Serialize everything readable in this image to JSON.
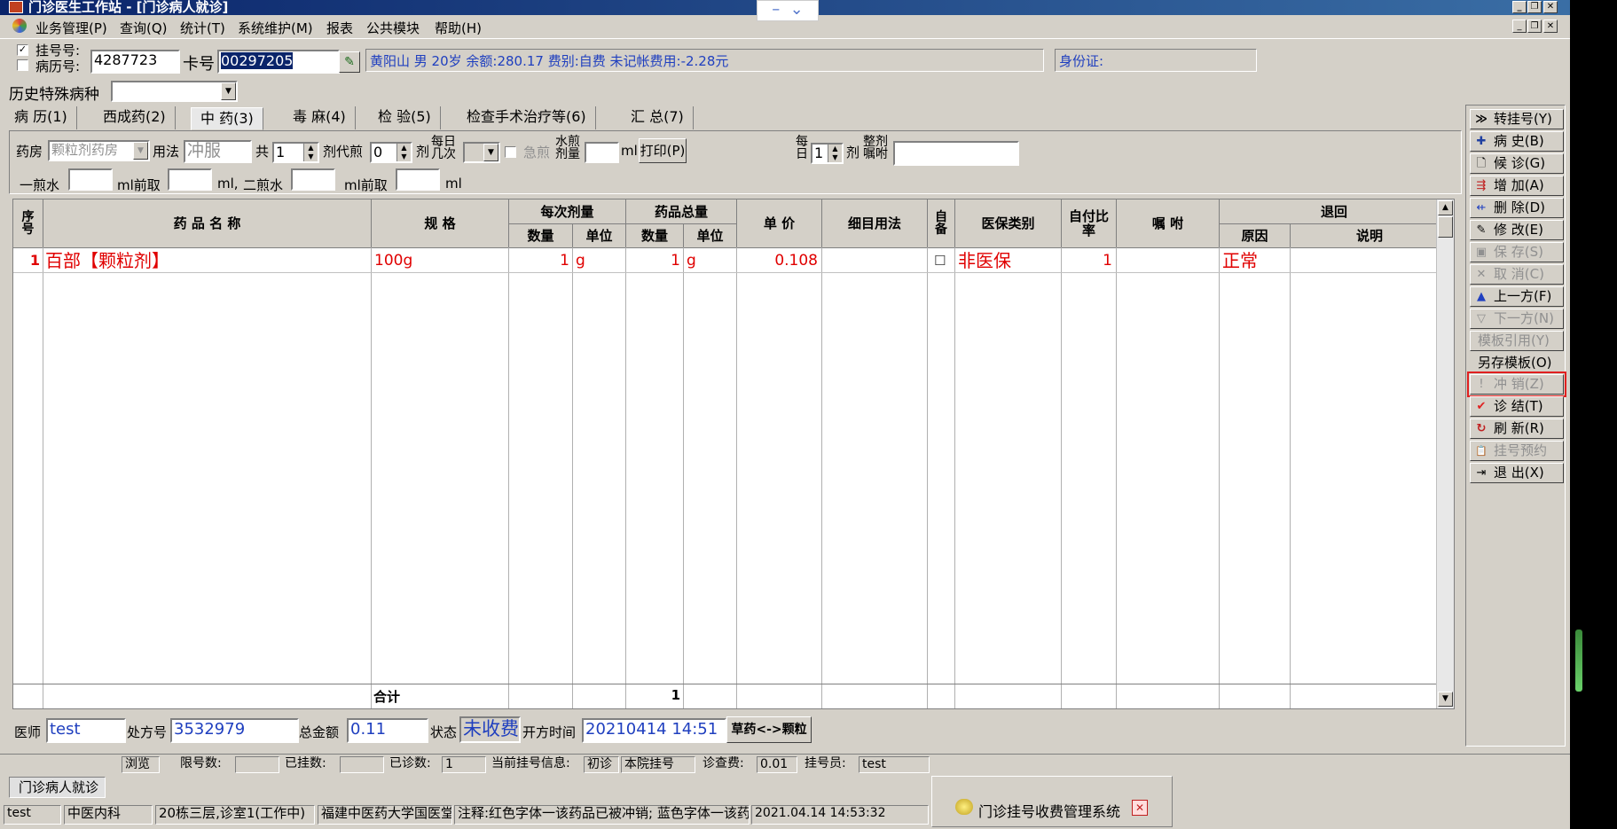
{
  "window": {
    "title": "门诊医生工作站 - [门诊病人就诊]"
  },
  "menu": [
    "业务管理(P)",
    "查询(Q)",
    "统计(T)",
    "系统维护(M)",
    "报表",
    "公共模块",
    "帮助(H)"
  ],
  "patient": {
    "reg_no_label": "挂号号:",
    "record_no_label": "病历号:",
    "reg_no": "4287723",
    "card_label": "卡号",
    "card_no": "00297205",
    "info": "黄阳山 男 20岁 余额:280.17 费别:自费 未记帐费用:-2.28元",
    "id_label": "身份证:",
    "history_label": "历史特殊病种"
  },
  "tabs": [
    "病 历(1)",
    "西成药(2)",
    "中 药(3)",
    "毒 麻(4)",
    "检 验(5)",
    "检查手术治疗等(6)",
    "汇 总(7)"
  ],
  "active_tab": 2,
  "herb": {
    "pharmacy_label": "药房",
    "pharmacy": "颗粒剂药房",
    "usage_label": "用法",
    "usage": "冲服",
    "total_label": "共",
    "total": "1",
    "dose_label": "剂代煎",
    "decoct": "0",
    "ji_label": "剂",
    "daily_label": "每日几次",
    "urgent_label": "急煎",
    "water_label": "水煎剂量",
    "ml_label": "ml",
    "print_btn": "打印(P)",
    "per_day_label": "每日",
    "per_day": "1",
    "ji2_label": "剂",
    "advice_label": "整剂嘱咐",
    "first_water_label": "一煎水",
    "first_take_label": "ml前取",
    "ml_comma": "ml,",
    "second_water_label": "二煎水",
    "second_take_label": "ml前取",
    "ml_end": "ml"
  },
  "grid": {
    "headers": {
      "seq": "序号",
      "name": "药 品 名 称",
      "spec": "规 格",
      "dose_group": "每次剂量",
      "total_group": "药品总量",
      "qty": "数量",
      "unit": "单位",
      "qty2": "数量",
      "unit2": "单位",
      "price": "单 价",
      "detail": "细目用法",
      "self": "自备",
      "insurance": "医保类别",
      "ratio": "自付比率",
      "advice": "嘱 咐",
      "refund_group": "退回",
      "reason": "原因",
      "note": "说明"
    },
    "rows": [
      {
        "seq": "1",
        "name": "百部【颗粒剂】",
        "spec": "100g",
        "qty": "1",
        "unit": "g",
        "total": "1",
        "unit2": "g",
        "price": "0.108",
        "detail": "",
        "self": "☐",
        "insurance": "非医保",
        "ratio": "1",
        "advice": "",
        "reason": "正常",
        "note": ""
      }
    ],
    "footer_label": "合计",
    "footer_total": "1"
  },
  "sidebar": [
    {
      "label": "转挂号(Y)",
      "icon": "double-chevron-icon",
      "glyph": "≫",
      "disabled": false
    },
    {
      "label": "病 史(B)",
      "icon": "plus-icon",
      "glyph": "✚",
      "disabled": false
    },
    {
      "label": "候 诊(G)",
      "icon": "document-icon",
      "glyph": "🗋",
      "disabled": false
    },
    {
      "label": "增 加(A)",
      "icon": "add-row-icon",
      "glyph": "⇶",
      "disabled": false
    },
    {
      "label": "删 除(D)",
      "icon": "delete-row-icon",
      "glyph": "⇷",
      "disabled": false
    },
    {
      "label": "修 改(E)",
      "icon": "edit-icon",
      "glyph": "✎",
      "disabled": false
    },
    {
      "label": "保 存(S)",
      "icon": "save-icon",
      "glyph": "▣",
      "disabled": true
    },
    {
      "label": "取 消(C)",
      "icon": "cancel-icon",
      "glyph": "✕",
      "disabled": true
    },
    {
      "label": "上一方(F)",
      "icon": "up-icon",
      "glyph": "▲",
      "disabled": false
    },
    {
      "label": "下一方(N)",
      "icon": "down-icon",
      "glyph": "▽",
      "disabled": true
    },
    {
      "label": "模板引用(Y)",
      "icon": "",
      "glyph": "",
      "disabled": true
    },
    {
      "label": "另存模板(O)",
      "icon": "",
      "glyph": "",
      "disabled": false
    },
    {
      "label": "冲 销(Z)",
      "icon": "exclaim-icon",
      "glyph": "!",
      "disabled": true
    },
    {
      "label": "诊 结(T)",
      "icon": "check-icon",
      "glyph": "✔",
      "disabled": false
    },
    {
      "label": "刷 新(R)",
      "icon": "refresh-icon",
      "glyph": "↻",
      "disabled": false
    },
    {
      "label": "挂号预约",
      "icon": "clipboard-icon",
      "glyph": "📋",
      "disabled": true
    },
    {
      "label": "退 出(X)",
      "icon": "exit-icon",
      "glyph": "⇥",
      "disabled": false
    }
  ],
  "bottom": {
    "doctor_label": "医师",
    "doctor": "test",
    "rx_label": "处方号",
    "rx_no": "3532979",
    "amount_label": "总金额",
    "amount": "0.11",
    "status_label": "状态",
    "status": "未收费",
    "time_label": "开方时间",
    "time": "20210414 14:51",
    "switch_btn": "草药<->颗粒"
  },
  "status": {
    "browse": "浏览",
    "limit_label": "限号数:",
    "limit": "",
    "registered_label": "已挂数:",
    "registered": "",
    "diagnosed_label": "已诊数:",
    "diagnosed": "1",
    "current_label": "当前挂号信息:",
    "current_type": "初诊",
    "current_kind": "本院挂号",
    "fee_label": "诊查费:",
    "fee": "0.01",
    "clerk_label": "挂号员:",
    "clerk": "test"
  },
  "taskbar": {
    "window_tab": "门诊病人就诊",
    "user": "test",
    "dept": "中医内科",
    "room": "20栋三层,诊室1(工作中)",
    "hospital": "福建中医药大学国医堂",
    "note": "注释:红色字体一该药品已被冲销; 蓝色字体一该药",
    "datetime": "2021.04.14 14:53:32",
    "popup": "门诊挂号收费管理系统"
  }
}
